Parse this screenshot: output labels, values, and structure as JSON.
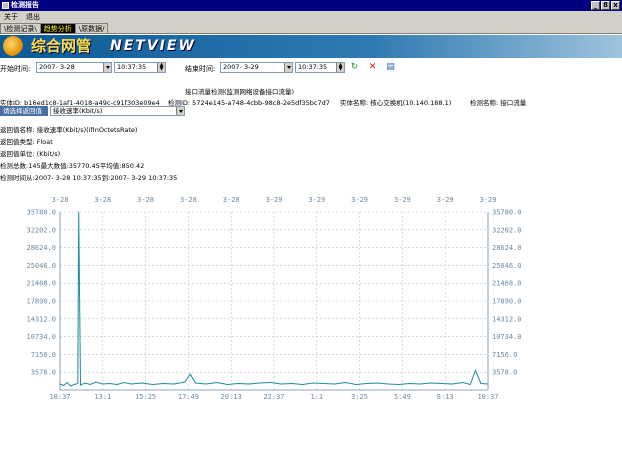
{
  "window": {
    "title": "检测报告",
    "buttons": [
      "_",
      "8",
      "x"
    ]
  },
  "menu": [
    "关于",
    "退出"
  ],
  "tabs": [
    {
      "label": "\\检测记录\\",
      "active": false
    },
    {
      "label": "趋势分析",
      "active": true
    },
    {
      "label": "\\原数据/",
      "active": false
    }
  ],
  "banner": {
    "brand_cn": "综合网管",
    "brand_en": "NETVIEW"
  },
  "timebar": {
    "start_label": "开始时间:",
    "start_date": "2007- 3-28",
    "start_time": "10:37:35",
    "end_label": "结束时间:",
    "end_date": "2007- 3-29",
    "end_time": "10:37:35",
    "icons": [
      "refresh-icon",
      "delete-icon",
      "export-icon"
    ]
  },
  "report": {
    "heading": "接口流量检测(监测网络设备接口流量)",
    "instance_id": "实体ID: b16ed1c8-1af1-4018-a49c-c91f303e09e4",
    "detector_id": "检测ID: 5724e145-a748-4cbb-98c8-2e5df35bc7d7",
    "instance_name": "实体名称: 核心交换机(10.140.188.1)",
    "detector_name": "检测名称: 接口流量"
  },
  "return_select": {
    "button": "请选择返回值",
    "value": "接收速率(Kbit/s)"
  },
  "details": [
    "返回值名称: 接收速率(Kbit/s)(ifInOctetsRate)",
    "返回值类型: Float",
    "返回值单位: (Kbit/s)",
    "检测总数:145最大数值:35770.45平均值:850.42",
    "检测时间从:2007- 3-28 10:37:35到:2007- 3-29 10:37:35"
  ],
  "colors": {
    "series": "#1f8a9c",
    "axis": "#6b8aa3",
    "banner": "#0c5a96"
  },
  "chart_data": {
    "type": "line",
    "top_labels": [
      "3-28",
      "3-28",
      "3-28",
      "3-28",
      "3-28",
      "3-29",
      "3-29",
      "3-29",
      "3-29",
      "3-29",
      "3-29"
    ],
    "x_labels": [
      "10:37",
      "13:1",
      "15:25",
      "17:49",
      "20:13",
      "22:37",
      "1:1",
      "3:25",
      "5:49",
      "8:13",
      "10:37"
    ],
    "y_labels": [
      "35780.0",
      "32202.0",
      "28624.0",
      "25046.0",
      "21468.0",
      "17890.0",
      "14312.0",
      "10734.0",
      "7156.0",
      "3578.0"
    ],
    "ylim": [
      0,
      35780
    ],
    "xlim": [
      0,
      24
    ],
    "grid": true,
    "series": [
      {
        "x": [
          0,
          0.2,
          0.4,
          0.6,
          0.8,
          1.0,
          1.05,
          1.15,
          1.4,
          1.7,
          2.0,
          2.4,
          2.8,
          3.2,
          3.6,
          4.0,
          4.6,
          5.2,
          5.8,
          6.4,
          7.0,
          7.3,
          7.6,
          8.2,
          8.8,
          9.4,
          10.0,
          10.6,
          11.2,
          11.8,
          12.4,
          13.0,
          13.6,
          14.2,
          14.8,
          15.4,
          16.0,
          16.6,
          17.2,
          17.8,
          18.4,
          19.0,
          19.6,
          20.2,
          20.8,
          21.4,
          22.0,
          22.6,
          23.0,
          23.3,
          23.6,
          24.0
        ],
        "y": [
          1200,
          900,
          1500,
          800,
          1100,
          1300,
          35770,
          1000,
          1400,
          1100,
          1600,
          1200,
          1300,
          1100,
          1500,
          1200,
          1400,
          1100,
          1300,
          1200,
          1600,
          3200,
          1400,
          1200,
          1500,
          1100,
          1300,
          1200,
          1400,
          1500,
          1200,
          1300,
          1100,
          1400,
          1300,
          1200,
          1500,
          1100,
          1300,
          1400,
          1200,
          1100,
          1300,
          1200,
          1400,
          1300,
          1200,
          1500,
          1100,
          3900,
          1300,
          1200
        ]
      }
    ]
  }
}
